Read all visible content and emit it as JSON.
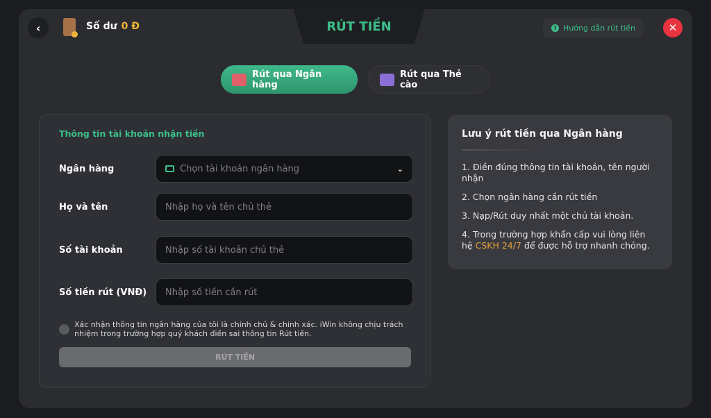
{
  "header": {
    "balance_label": "Số dư",
    "balance_value": "0 Đ",
    "title": "RÚT TIỀN",
    "guide_label": "Hướng dẫn rút tiền"
  },
  "tabs": [
    {
      "label": "Rút qua Ngân hàng",
      "active": true
    },
    {
      "label": "Rút qua Thẻ cào",
      "active": false
    }
  ],
  "form": {
    "section_title": "Thông tin tài khoản nhận tiền",
    "fields": [
      {
        "label": "Ngân hàng",
        "placeholder": "Chọn tài khoản ngân hàng"
      },
      {
        "label": "Họ và tên",
        "placeholder": "Nhập họ và tên chủ thẻ"
      },
      {
        "label": "Số tài khoản",
        "placeholder": "Nhập số tài khoản chủ thẻ"
      },
      {
        "label": "Số tiền rút (VNĐ)",
        "placeholder": "Nhập số tiền cần rút"
      }
    ],
    "consent": "Xác nhận thông tin ngân hàng của tôi là chính chủ & chính xác. iWin không chịu trách nhiệm trong trường hợp quý khách điền sai thông tin Rút tiền.",
    "consent_checked": false,
    "submit_label": "RÚT TIỀN"
  },
  "notes": {
    "title": "Lưu ý rút tiền qua Ngân hàng",
    "items": [
      "1. Điền đúng thông tin tài khoản, tên người nhận",
      "2. Chọn ngân hàng cần rút tiền",
      "3. Nạp/Rút duy nhất một chủ tài khoản."
    ],
    "item4_prefix": "4. Trong trường hợp khẩn cấp vui lòng liên hệ ",
    "item4_highlight": "CSKH 24/7",
    "item4_suffix": " để được hỗ trợ nhanh chóng."
  },
  "colors": {
    "accent": "#3dbf8a",
    "highlight": "#e6a23c",
    "close": "#e8343f"
  }
}
